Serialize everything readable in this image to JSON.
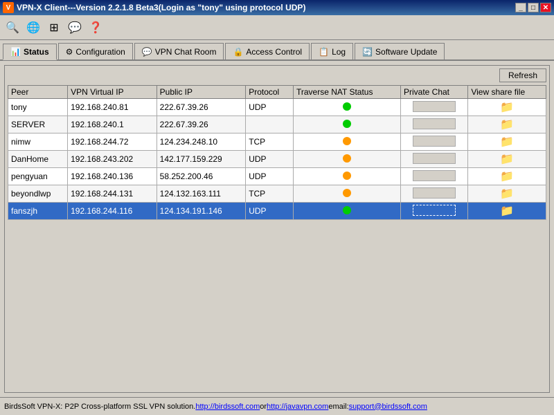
{
  "window": {
    "title": "VPN-X Client---Version 2.2.1.8 Beta3(Login as \"tony\" using protocol UDP)",
    "user": "tony"
  },
  "title_buttons": {
    "minimize": "_",
    "maximize": "□",
    "close": "✕"
  },
  "toolbar": {
    "icons": [
      "🔍",
      "🌐",
      "⊞",
      "💬",
      "❓"
    ]
  },
  "tabs": [
    {
      "id": "status",
      "label": "Status",
      "icon": "📊",
      "active": true
    },
    {
      "id": "configuration",
      "label": "Configuration",
      "icon": "⚙"
    },
    {
      "id": "vpn-chat-room",
      "label": "VPN Chat Room",
      "icon": "💬"
    },
    {
      "id": "access-control",
      "label": "Access Control",
      "icon": "🔒"
    },
    {
      "id": "log",
      "label": "Log",
      "icon": "📋"
    },
    {
      "id": "software-update",
      "label": "Software Update",
      "icon": "🔄"
    }
  ],
  "refresh_button": "Refresh",
  "table": {
    "headers": [
      "Peer",
      "VPN Virtual IP",
      "Public IP",
      "Protocol",
      "Traverse NAT Status",
      "Private Chat",
      "View share file"
    ],
    "rows": [
      {
        "peer": "tony",
        "vpn_ip": "192.168.240.81",
        "public_ip": "222.67.39.26",
        "protocol": "UDP",
        "nat_status": "green",
        "highlight": false
      },
      {
        "peer": "SERVER",
        "vpn_ip": "192.168.240.1",
        "public_ip": "222.67.39.26",
        "protocol": "",
        "nat_status": "green",
        "highlight": false
      },
      {
        "peer": "nimw",
        "vpn_ip": "192.168.244.72",
        "public_ip": "124.234.248.10",
        "protocol": "TCP",
        "nat_status": "orange",
        "highlight": false
      },
      {
        "peer": "DanHome",
        "vpn_ip": "192.168.243.202",
        "public_ip": "142.177.159.229",
        "protocol": "UDP",
        "nat_status": "orange",
        "highlight": false
      },
      {
        "peer": "pengyuan",
        "vpn_ip": "192.168.240.136",
        "public_ip": "58.252.200.46",
        "protocol": "UDP",
        "nat_status": "orange",
        "highlight": false
      },
      {
        "peer": "beyondlwp",
        "vpn_ip": "192.168.244.131",
        "public_ip": "124.132.163.111",
        "protocol": "TCP",
        "nat_status": "orange",
        "highlight": false
      },
      {
        "peer": "fanszjh",
        "vpn_ip": "192.168.244.116",
        "public_ip": "124.134.191.146",
        "protocol": "UDP",
        "nat_status": "green",
        "highlight": true
      }
    ]
  },
  "footer": {
    "text": "BirdsSoft VPN-X: P2P Cross-platform SSL VPN solution. ",
    "link1_text": "http://birdssoft.com",
    "link1_url": "#",
    "or_text": " or ",
    "link2_text": "http://javavpn.com",
    "link2_url": "#",
    "email_text": " email:",
    "email_link_text": "support@birdssoft.com",
    "email_url": "#"
  }
}
